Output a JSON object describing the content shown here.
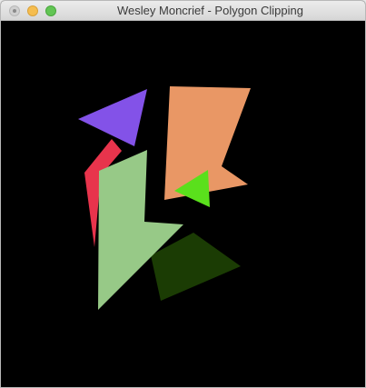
{
  "window": {
    "title": "Wesley Moncrief - Polygon Clipping"
  },
  "colors": {
    "canvas_background": "#000000",
    "purple": "#8352e8",
    "red": "#e8344c",
    "orange": "#e99765",
    "light_green": "#97c987",
    "bright_green": "#5ae01c",
    "dark_green": "#1b3c04"
  },
  "icons": {
    "close": "close-button-icon",
    "minimize": "minimize-button-icon",
    "zoom": "zoom-button-icon"
  }
}
